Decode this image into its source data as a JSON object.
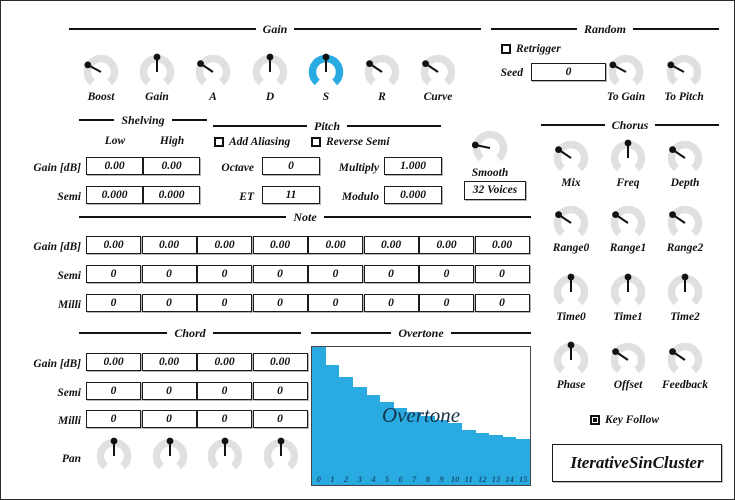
{
  "app": {
    "name": "IterativeSinCluster"
  },
  "sections": {
    "gain": "Gain",
    "random": "Random",
    "shelving": "Shelving",
    "pitch": "Pitch",
    "chorus": "Chorus",
    "note": "Note",
    "chord": "Chord",
    "overtone": "Overtone"
  },
  "gain": {
    "knobs": [
      {
        "label": "Boost",
        "value": 0.28,
        "active": false
      },
      {
        "label": "Gain",
        "value": 0.5,
        "active": false
      },
      {
        "label": "A",
        "value": 0.3,
        "active": false
      },
      {
        "label": "D",
        "value": 0.5,
        "active": false
      },
      {
        "label": "S",
        "value": 0.5,
        "active": true
      },
      {
        "label": "R",
        "value": 0.3,
        "active": false
      },
      {
        "label": "Curve",
        "value": 0.3,
        "active": false
      }
    ]
  },
  "random": {
    "retrigger": {
      "label": "Retrigger",
      "checked": false
    },
    "seed": {
      "label": "Seed",
      "value": "0"
    },
    "knobs": [
      {
        "label": "To Gain",
        "value": 0.28,
        "active": false
      },
      {
        "label": "To Pitch",
        "value": 0.28,
        "active": false
      }
    ]
  },
  "shelving": {
    "columns": [
      "Low",
      "High"
    ],
    "rows": [
      {
        "label": "Gain [dB]",
        "values": [
          "0.00",
          "0.00"
        ]
      },
      {
        "label": "Semi",
        "values": [
          "0.000",
          "0.000"
        ]
      }
    ]
  },
  "pitch": {
    "add_aliasing": {
      "label": "Add Aliasing",
      "checked": false
    },
    "reverse_semi": {
      "label": "Reverse Semi",
      "checked": false
    },
    "fields": [
      {
        "label": "Octave",
        "value": "0"
      },
      {
        "label": "ET",
        "value": "11"
      },
      {
        "label": "Multiply",
        "value": "1.000"
      },
      {
        "label": "Modulo",
        "value": "0.000"
      }
    ]
  },
  "smooth": {
    "knob": {
      "label": "Smooth",
      "value": 0.22,
      "active": false
    },
    "voices_button": "32 Voices"
  },
  "note": {
    "row_labels": [
      "Gain [dB]",
      "Semi",
      "Milli"
    ],
    "gain_values": [
      "0.00",
      "0.00",
      "0.00",
      "0.00",
      "0.00",
      "0.00",
      "0.00",
      "0.00"
    ],
    "semi_values": [
      "0",
      "0",
      "0",
      "0",
      "0",
      "0",
      "0",
      "0"
    ],
    "milli_values": [
      "0",
      "0",
      "0",
      "0",
      "0",
      "0",
      "0",
      "0"
    ]
  },
  "chord": {
    "row_labels": [
      "Gain [dB]",
      "Semi",
      "Milli",
      "Pan"
    ],
    "gain_values": [
      "0.00",
      "0.00",
      "0.00",
      "0.00"
    ],
    "semi_values": [
      "0",
      "0",
      "0",
      "0"
    ],
    "milli_values": [
      "0",
      "0",
      "0",
      "0"
    ],
    "pan_knobs": [
      {
        "label": "",
        "value": 0.5,
        "active": false
      },
      {
        "label": "",
        "value": 0.5,
        "active": false
      },
      {
        "label": "",
        "value": 0.5,
        "active": false
      },
      {
        "label": "",
        "value": 0.5,
        "active": false
      }
    ]
  },
  "chorus": {
    "knobs": [
      {
        "label": "Mix",
        "value": 0.3,
        "active": false
      },
      {
        "label": "Freq",
        "value": 0.5,
        "active": false
      },
      {
        "label": "Depth",
        "value": 0.3,
        "active": false
      },
      {
        "label": "Range0",
        "value": 0.3,
        "active": false
      },
      {
        "label": "Range1",
        "value": 0.3,
        "active": false
      },
      {
        "label": "Range2",
        "value": 0.3,
        "active": false
      },
      {
        "label": "Time0",
        "value": 0.5,
        "active": false
      },
      {
        "label": "Time1",
        "value": 0.5,
        "active": false
      },
      {
        "label": "Time2",
        "value": 0.5,
        "active": false
      },
      {
        "label": "Phase",
        "value": 0.5,
        "active": false
      },
      {
        "label": "Offset",
        "value": 0.3,
        "active": false
      },
      {
        "label": "Feedback",
        "value": 0.3,
        "active": false
      }
    ],
    "key_follow": {
      "label": "Key Follow",
      "checked": true
    }
  },
  "colors": {
    "accent": "#29ABE2",
    "knob_track": "#e0e0e0",
    "pointer": "#111111",
    "text": "#111111",
    "background": "#ffffff"
  },
  "chart_data": {
    "type": "bar",
    "title": "Overtone",
    "categories": [
      "0",
      "1",
      "2",
      "3",
      "4",
      "5",
      "6",
      "7",
      "8",
      "9",
      "10",
      "11",
      "12",
      "13",
      "14",
      "15"
    ],
    "values": [
      1.0,
      0.87,
      0.78,
      0.71,
      0.65,
      0.6,
      0.56,
      0.53,
      0.5,
      0.47,
      0.45,
      0.4,
      0.38,
      0.36,
      0.35,
      0.33
    ],
    "xlabel": "",
    "ylabel": "",
    "ylim": [
      0,
      1
    ],
    "grid": false,
    "legend": "none",
    "bar_color": "#29ABE2"
  }
}
